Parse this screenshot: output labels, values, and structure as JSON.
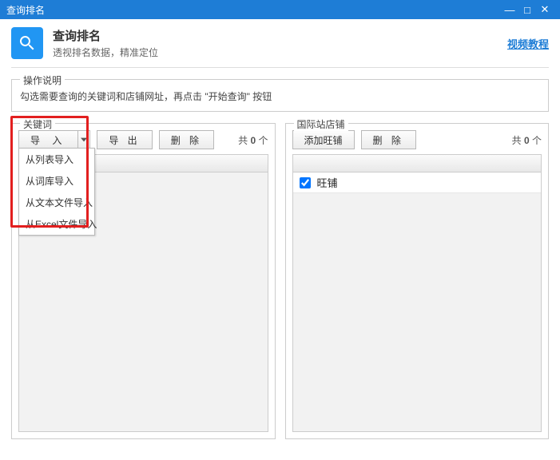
{
  "window": {
    "title": "查询排名"
  },
  "header": {
    "title": "查询排名",
    "subtitle": "透视排名数据，精准定位",
    "tutorial_link": "视频教程"
  },
  "instructions": {
    "legend": "操作说明",
    "text": "勾选需要查询的关键词和店铺网址，再点击 \"开始查询\" 按钮"
  },
  "left_pane": {
    "legend": "关键词",
    "import_btn": "导  入",
    "export_btn": "导  出",
    "delete_btn": "删  除",
    "count_prefix": "共",
    "count_value": "0",
    "count_suffix": "个",
    "dropdown": {
      "items": [
        "从列表导入",
        "从词库导入",
        "从文本文件导入",
        "从Excel文件导入"
      ]
    }
  },
  "right_pane": {
    "legend": "国际站店铺",
    "add_btn": "添加旺铺",
    "delete_btn": "删  除",
    "count_prefix": "共",
    "count_value": "0",
    "count_suffix": "个",
    "rows": [
      {
        "checked": true,
        "label": "旺铺"
      }
    ]
  }
}
